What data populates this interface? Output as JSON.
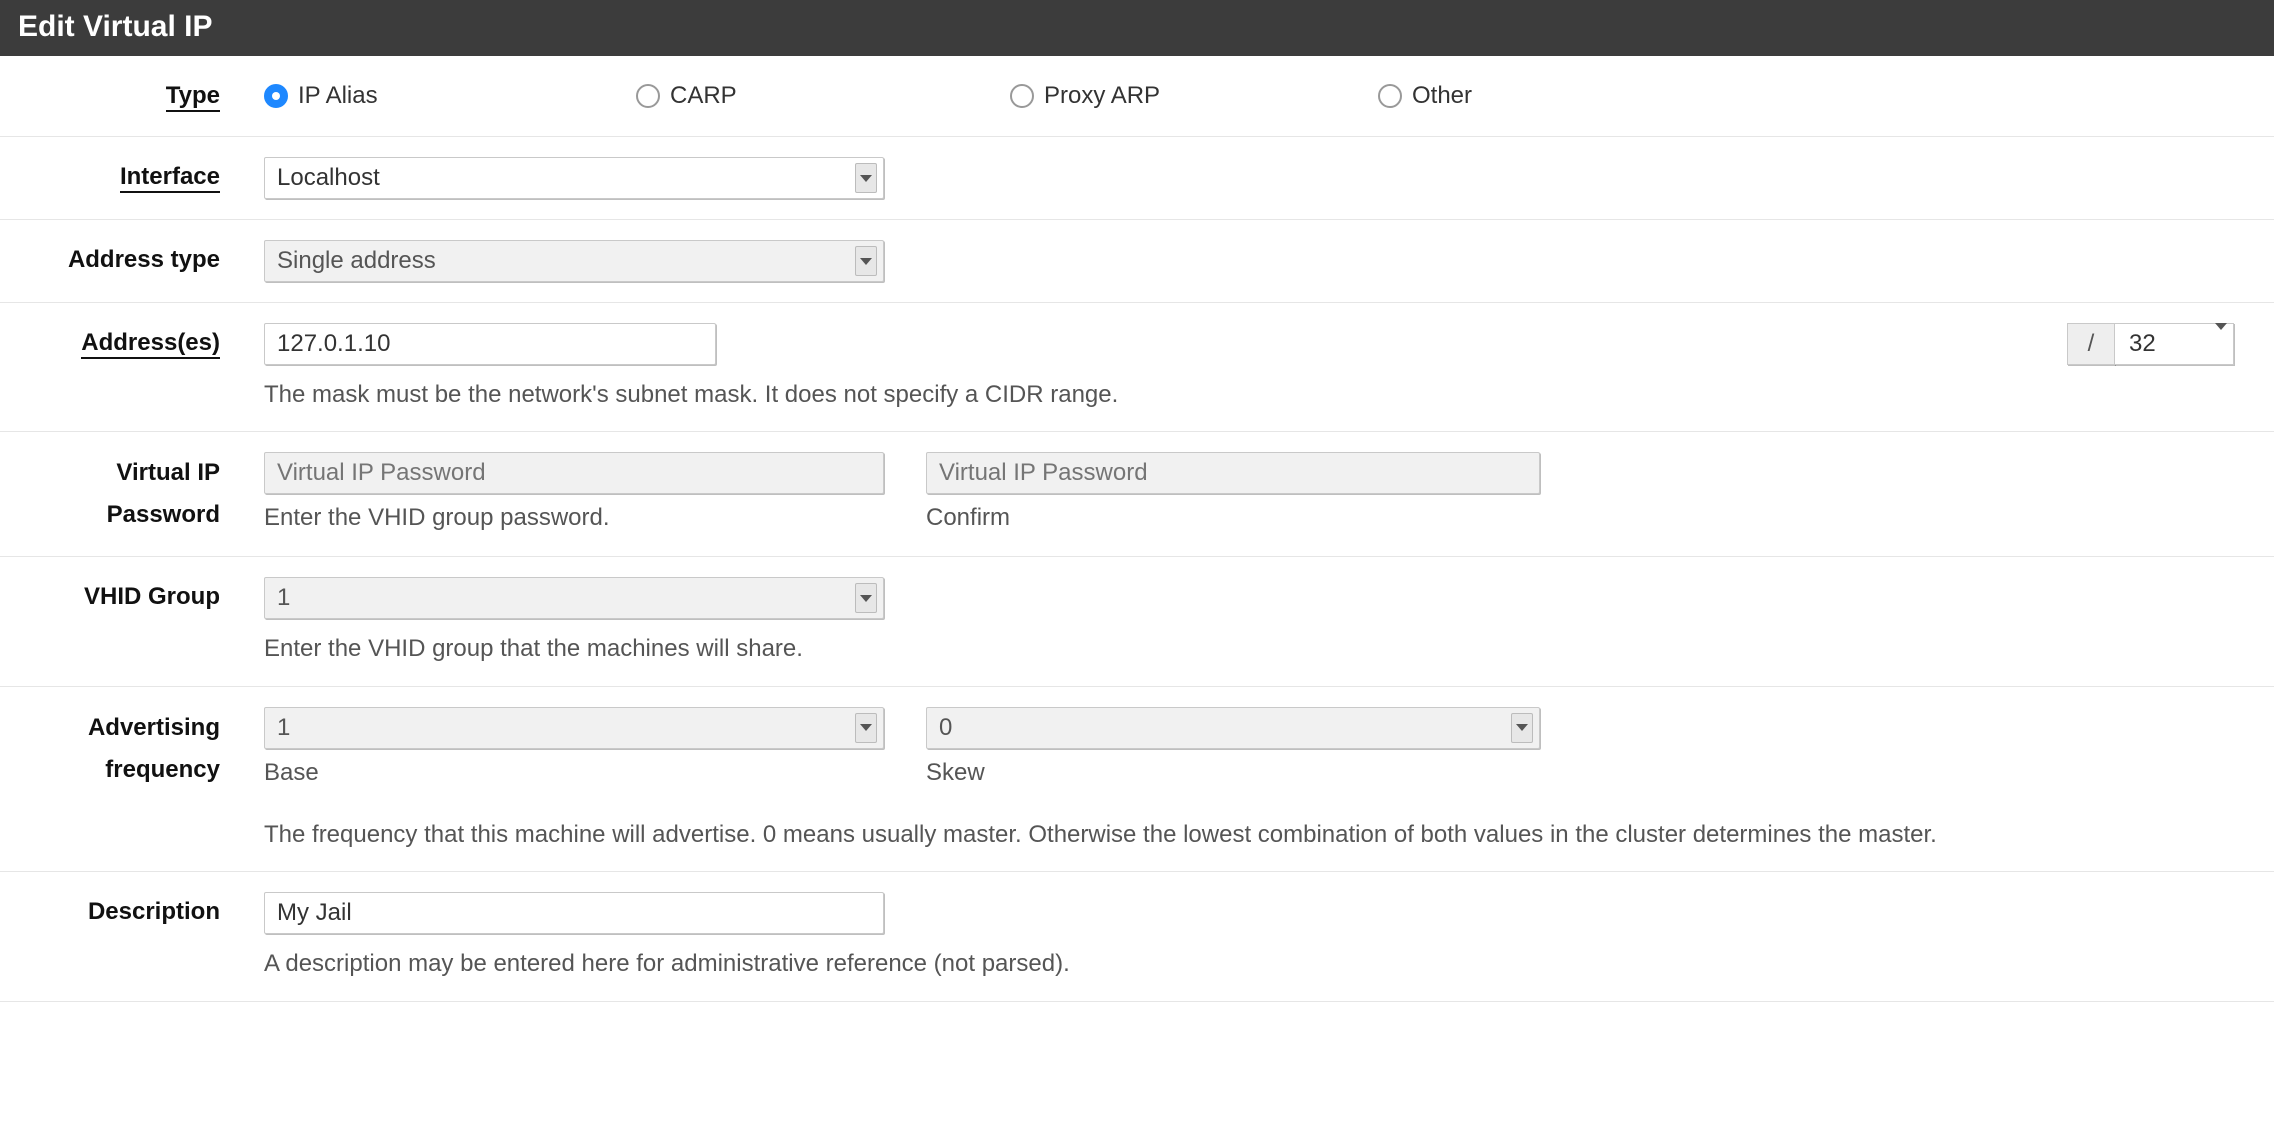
{
  "panel": {
    "title": "Edit Virtual IP"
  },
  "type": {
    "label": "Type",
    "options": {
      "ip_alias": "IP Alias",
      "carp": "CARP",
      "proxy_arp": "Proxy ARP",
      "other": "Other"
    },
    "selected": "ip_alias"
  },
  "interface": {
    "label": "Interface",
    "value": "Localhost"
  },
  "address_type": {
    "label": "Address type",
    "value": "Single address"
  },
  "addresses": {
    "label": "Address(es)",
    "value": "127.0.1.10",
    "slash": "/",
    "mask": "32",
    "help": "The mask must be the network's subnet mask. It does not specify a CIDR range."
  },
  "vip_password": {
    "label": "Virtual IP Password",
    "placeholder": "Virtual IP Password",
    "help": "Enter the VHID group password.",
    "confirm_placeholder": "Virtual IP Password",
    "confirm_label": "Confirm"
  },
  "vhid": {
    "label": "VHID Group",
    "value": "1",
    "help": "Enter the VHID group that the machines will share."
  },
  "advfreq": {
    "label": "Advertising frequency",
    "base_value": "1",
    "base_label": "Base",
    "skew_value": "0",
    "skew_label": "Skew",
    "help": "The frequency that this machine will advertise. 0 means usually master. Otherwise the lowest combination of both values in the cluster determines the master."
  },
  "description": {
    "label": "Description",
    "value": "My Jail",
    "help": "A description may be entered here for administrative reference (not parsed)."
  }
}
